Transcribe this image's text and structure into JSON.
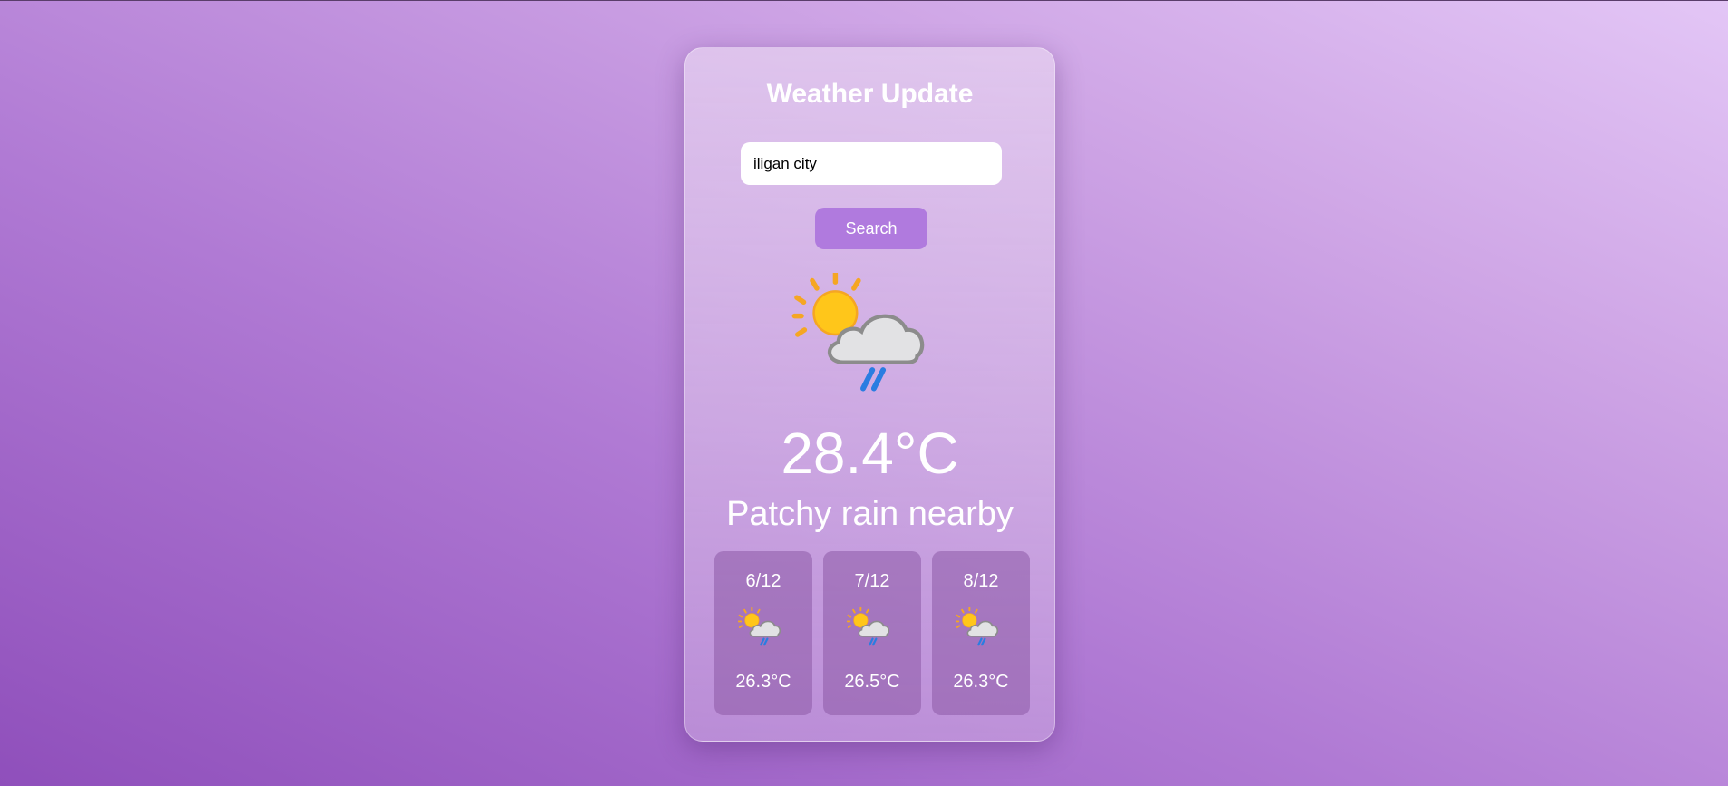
{
  "app": {
    "title": "Weather Update"
  },
  "search": {
    "value": "iligan city",
    "button_label": "Search"
  },
  "current": {
    "icon": "sun-cloud-rain-icon",
    "temperature": "28.4°C",
    "condition": "Patchy rain nearby"
  },
  "forecast": [
    {
      "date": "6/12",
      "icon": "sun-cloud-rain-icon",
      "temperature": "26.3°C"
    },
    {
      "date": "7/12",
      "icon": "sun-cloud-rain-icon",
      "temperature": "26.5°C"
    },
    {
      "date": "8/12",
      "icon": "sun-cloud-rain-icon",
      "temperature": "26.3°C"
    }
  ],
  "colors": {
    "accent": "#b07ade",
    "text": "#ffffff"
  }
}
